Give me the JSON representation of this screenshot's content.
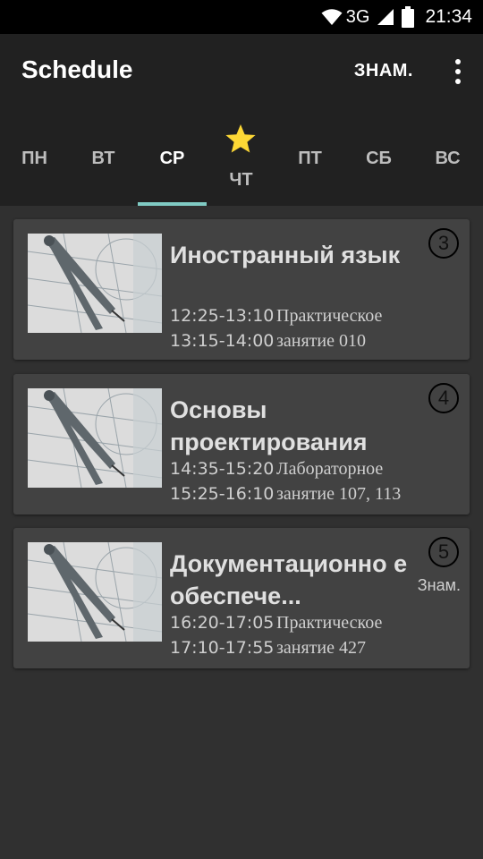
{
  "status_bar": {
    "network": "3G",
    "time": "21:34",
    "icons": [
      "wifi-icon",
      "signal-icon",
      "battery-icon"
    ]
  },
  "appbar": {
    "title": "Schedule",
    "action_label": "ЗНАМ.",
    "overflow_icon": "more-vert-icon"
  },
  "tabs": [
    {
      "label": "ПН"
    },
    {
      "label": "ВТ"
    },
    {
      "label": "СР",
      "active": true
    },
    {
      "label": "ЧТ",
      "icon": "star-icon"
    },
    {
      "label": "ПТ"
    },
    {
      "label": "СБ"
    },
    {
      "label": "ВС"
    }
  ],
  "colors": {
    "accent": "#80cbc4",
    "star": "#fdd835",
    "card_bg": "#424242",
    "appbar_bg": "#212121",
    "page_bg": "#303030"
  },
  "lessons": [
    {
      "number": "3",
      "title": "Иностранный язык",
      "time1": "12:25-13:10",
      "time2": "13:15-14:00",
      "type_line1": "Практическое",
      "type_line2": "занятие 010",
      "tag": ""
    },
    {
      "number": "4",
      "title": "Основы проектирования",
      "time1": "14:35-15:20",
      "time2": "15:25-16:10",
      "type_line1": "Лабораторное",
      "type_line2": "занятие 107, 113",
      "tag": ""
    },
    {
      "number": "5",
      "title": "Документационно е обеспече...",
      "time1": "16:20-17:05",
      "time2": "17:10-17:55",
      "type_line1": "Практическое",
      "type_line2": "занятие 427",
      "tag": "Знам."
    }
  ]
}
